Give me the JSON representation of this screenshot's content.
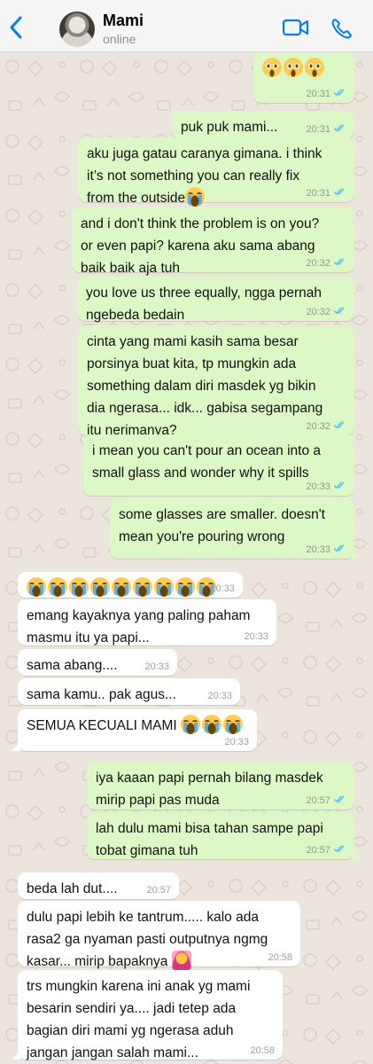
{
  "header": {
    "contact_name": "Mami",
    "status": "online"
  },
  "theme": {
    "accent": "#007aff",
    "outgoing_bubble": "#dcf8c6",
    "incoming_bubble": "#ffffff",
    "read_ticks": "#4fc3f7"
  },
  "icons": {
    "back": "chevron-left-icon",
    "video": "video-camera-icon",
    "call": "phone-icon",
    "read": "double-check-icon"
  },
  "messages": [
    {
      "dir": "out",
      "text": "",
      "emojis": [
        "pleading",
        "pleading",
        "pleading"
      ],
      "time": "20:31",
      "read": true
    },
    {
      "dir": "out",
      "text": "puk puk mami...",
      "time": "20:31",
      "read": true
    },
    {
      "dir": "out",
      "text": "aku juga gatau caranya gimana. i think\nit’s not something you can really fix\nfrom the outside",
      "emojis": [
        "crying"
      ],
      "time": "20:31",
      "read": true
    },
    {
      "dir": "out",
      "text": "and i don't think the problem is on you?\nor even papi? karena aku sama abang\nbaik baik aja tuh",
      "time": "20:32",
      "read": true
    },
    {
      "dir": "out",
      "text": "you love us three equally, ngga pernah\nngebeda bedain",
      "time": "20:32",
      "read": true
    },
    {
      "dir": "out",
      "text": "cinta yang mami kasih sama besar\nporsinya buat kita, tp mungkin ada\nsomething dalam diri masdek yg bikin\ndia ngerasa... idk... gabisa segampang\nitu nerimanya?",
      "time": "20:32",
      "read": true
    },
    {
      "dir": "out",
      "text": "i mean you can't pour an ocean into a\nsmall glass and wonder why it spills",
      "time": "20:33",
      "read": true
    },
    {
      "dir": "out",
      "text": "some glasses are smaller. doesn't\nmean you're pouring wrong",
      "time": "20:33",
      "read": true
    },
    {
      "dir": "in",
      "text": "",
      "emojis": [
        "crying",
        "crying",
        "crying",
        "crying",
        "crying",
        "crying",
        "crying",
        "crying",
        "crying"
      ],
      "time": "20:33"
    },
    {
      "dir": "in",
      "text": "emang kayaknya yang paling paham\nmasmu itu ya papi...",
      "time": "20:33"
    },
    {
      "dir": "in",
      "text": "sama abang....",
      "time": "20:33"
    },
    {
      "dir": "in",
      "text": "sama kamu.. pak agus...",
      "time": "20:33"
    },
    {
      "dir": "in",
      "text": "SEMUA KECUALI MAMI ",
      "emojis": [
        "crying",
        "crying",
        "crying"
      ],
      "time": "20:33"
    },
    {
      "dir": "out",
      "text": "iya kaaan papi pernah bilang masdek\nmirip papi pas muda",
      "time": "20:57",
      "read": true
    },
    {
      "dir": "out",
      "text": "lah dulu mami bisa tahan sampe papi\ntobat gimana tuh",
      "time": "20:57",
      "read": true
    },
    {
      "dir": "in",
      "text": "beda lah dut....",
      "time": "20:57"
    },
    {
      "dir": "in",
      "text": "dulu papi lebih ke tantrum..... kalo ada\nrasa2 ga nyaman pasti outputnya ngmg\nkasar... mirip bapaknya ",
      "emojis": [
        "person-facepalming"
      ],
      "time": "20:58"
    },
    {
      "dir": "in",
      "text": "trs mungkin karena ini anak yg mami\nbesarin sendiri ya.... jadi tetep ada\nbagian diri mami yg ngerasa aduh\njangan jangan salah mami...",
      "time": "20:58"
    }
  ]
}
